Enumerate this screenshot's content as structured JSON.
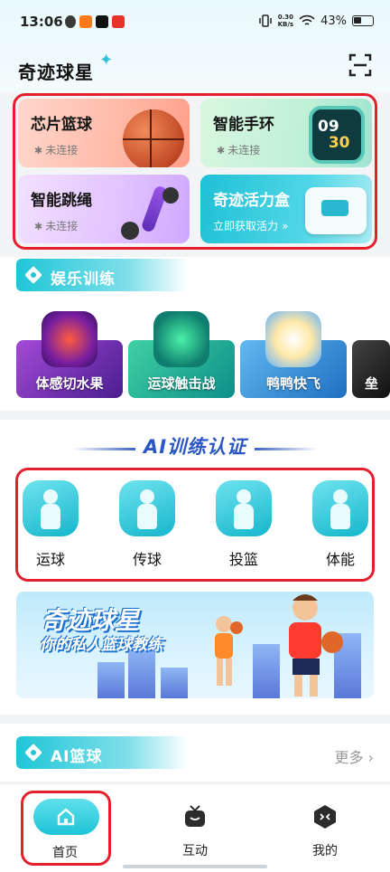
{
  "status_bar": {
    "time": "13:06",
    "speed_value": "0.30",
    "speed_unit": "KB/s",
    "battery": "43%"
  },
  "header": {
    "title": "奇迹球星"
  },
  "devices": [
    {
      "name": "芯片篮球",
      "status": "未连接"
    },
    {
      "name": "智能手环",
      "status": "未连接",
      "watch_hour": "09",
      "watch_min": "30"
    },
    {
      "name": "智能跳绳",
      "status": "未连接"
    },
    {
      "name": "奇迹活力盒",
      "status": "立即获取活力"
    }
  ],
  "entertainment": {
    "title": "娱乐训练",
    "games": [
      "体感切水果",
      "运球触击战",
      "鸭鸭快飞",
      "垒"
    ]
  },
  "ai_training": {
    "title": "AI训练认证",
    "skills": [
      "运球",
      "传球",
      "投篮",
      "体能"
    ]
  },
  "banner": {
    "line1": "奇迹球星",
    "line2": "你的私人篮球教练"
  },
  "ai_basketball": {
    "title": "AI篮球",
    "more": "更多"
  },
  "tabs": [
    {
      "label": "首页"
    },
    {
      "label": "互动"
    },
    {
      "label": "我的"
    }
  ],
  "colors": {
    "accent": "#1fc6d8",
    "highlight_border": "#e5202c"
  }
}
